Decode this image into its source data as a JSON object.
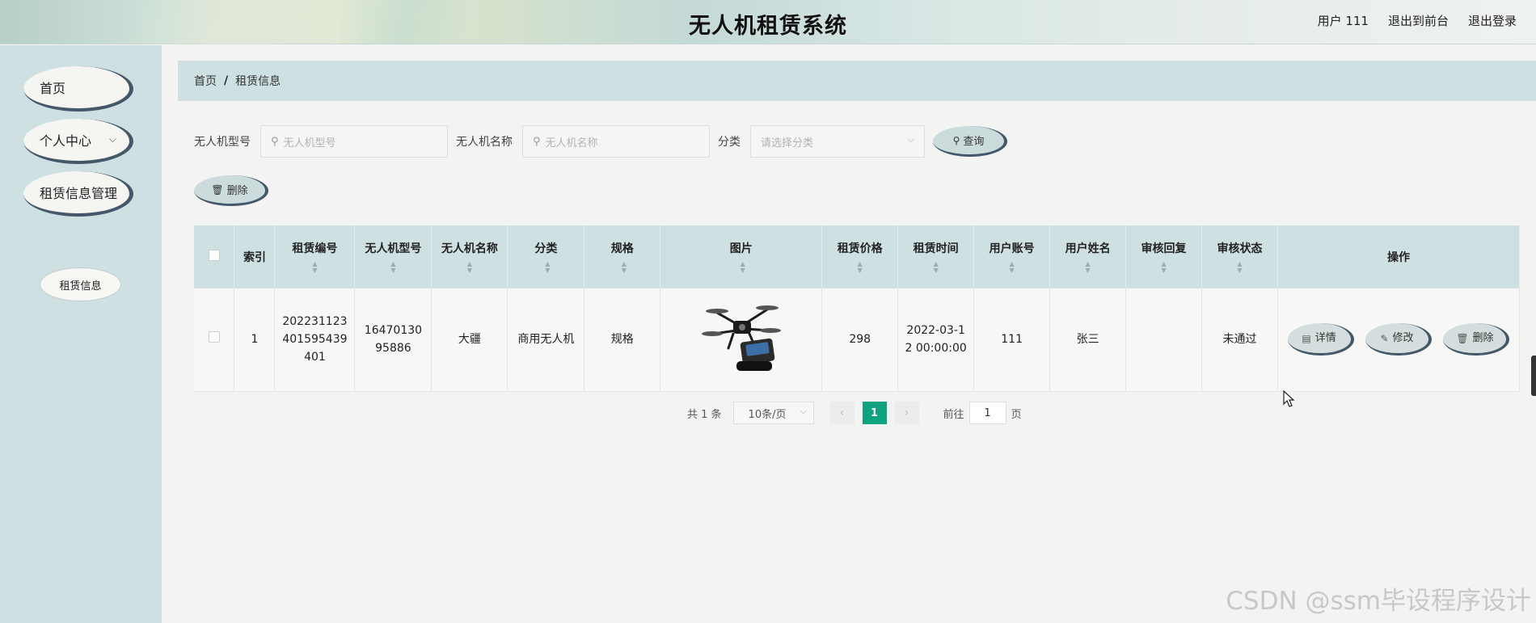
{
  "header": {
    "title": "无人机租赁系统",
    "user": "用户 111",
    "back_front": "退出到前台",
    "logout": "退出登录"
  },
  "sidebar": {
    "items": [
      {
        "label": "首页"
      },
      {
        "label": "个人中心",
        "chevron": "chevron-down-icon"
      },
      {
        "label": "租赁信息管理"
      }
    ],
    "sub_item": "租赁信息"
  },
  "breadcrumb": {
    "home": "首页",
    "separator": "/",
    "current": "租赁信息"
  },
  "search": {
    "model_label": "无人机型号",
    "model_placeholder": "无人机型号",
    "name_label": "无人机名称",
    "name_placeholder": "无人机名称",
    "category_label": "分类",
    "category_placeholder": "请选择分类",
    "query_button": "查询"
  },
  "toolbar": {
    "delete_button": "删除"
  },
  "table": {
    "columns": [
      "索引",
      "租赁编号",
      "无人机型号",
      "无人机名称",
      "分类",
      "规格",
      "图片",
      "租赁价格",
      "租赁时间",
      "用户账号",
      "用户姓名",
      "审核回复",
      "审核状态",
      "操作"
    ],
    "rows": [
      {
        "index": "1",
        "rental_no_lines": [
          "202231123",
          "401595439",
          "401"
        ],
        "model_lines": [
          "16470130",
          "95886"
        ],
        "name": "大疆",
        "category": "商用无人机",
        "spec": "规格",
        "image": "drone-image",
        "price": "298",
        "time_lines": [
          "2022-03-1",
          "2 00:00:00"
        ],
        "account": "111",
        "username": "张三",
        "reply": "",
        "status": "未通过",
        "actions": {
          "detail": "详情",
          "edit": "修改",
          "delete": "删除"
        }
      }
    ]
  },
  "pagination": {
    "total": "共 1 条",
    "page_size": "10条/页",
    "current_page": "1",
    "goto_label": "前往",
    "goto_value": "1",
    "page_suffix": "页"
  },
  "watermark": "CSDN @ssm毕设程序设计",
  "colors": {
    "accent": "#10a37f",
    "panel": "#cfe0e2",
    "button_shadow": "#44586a"
  }
}
